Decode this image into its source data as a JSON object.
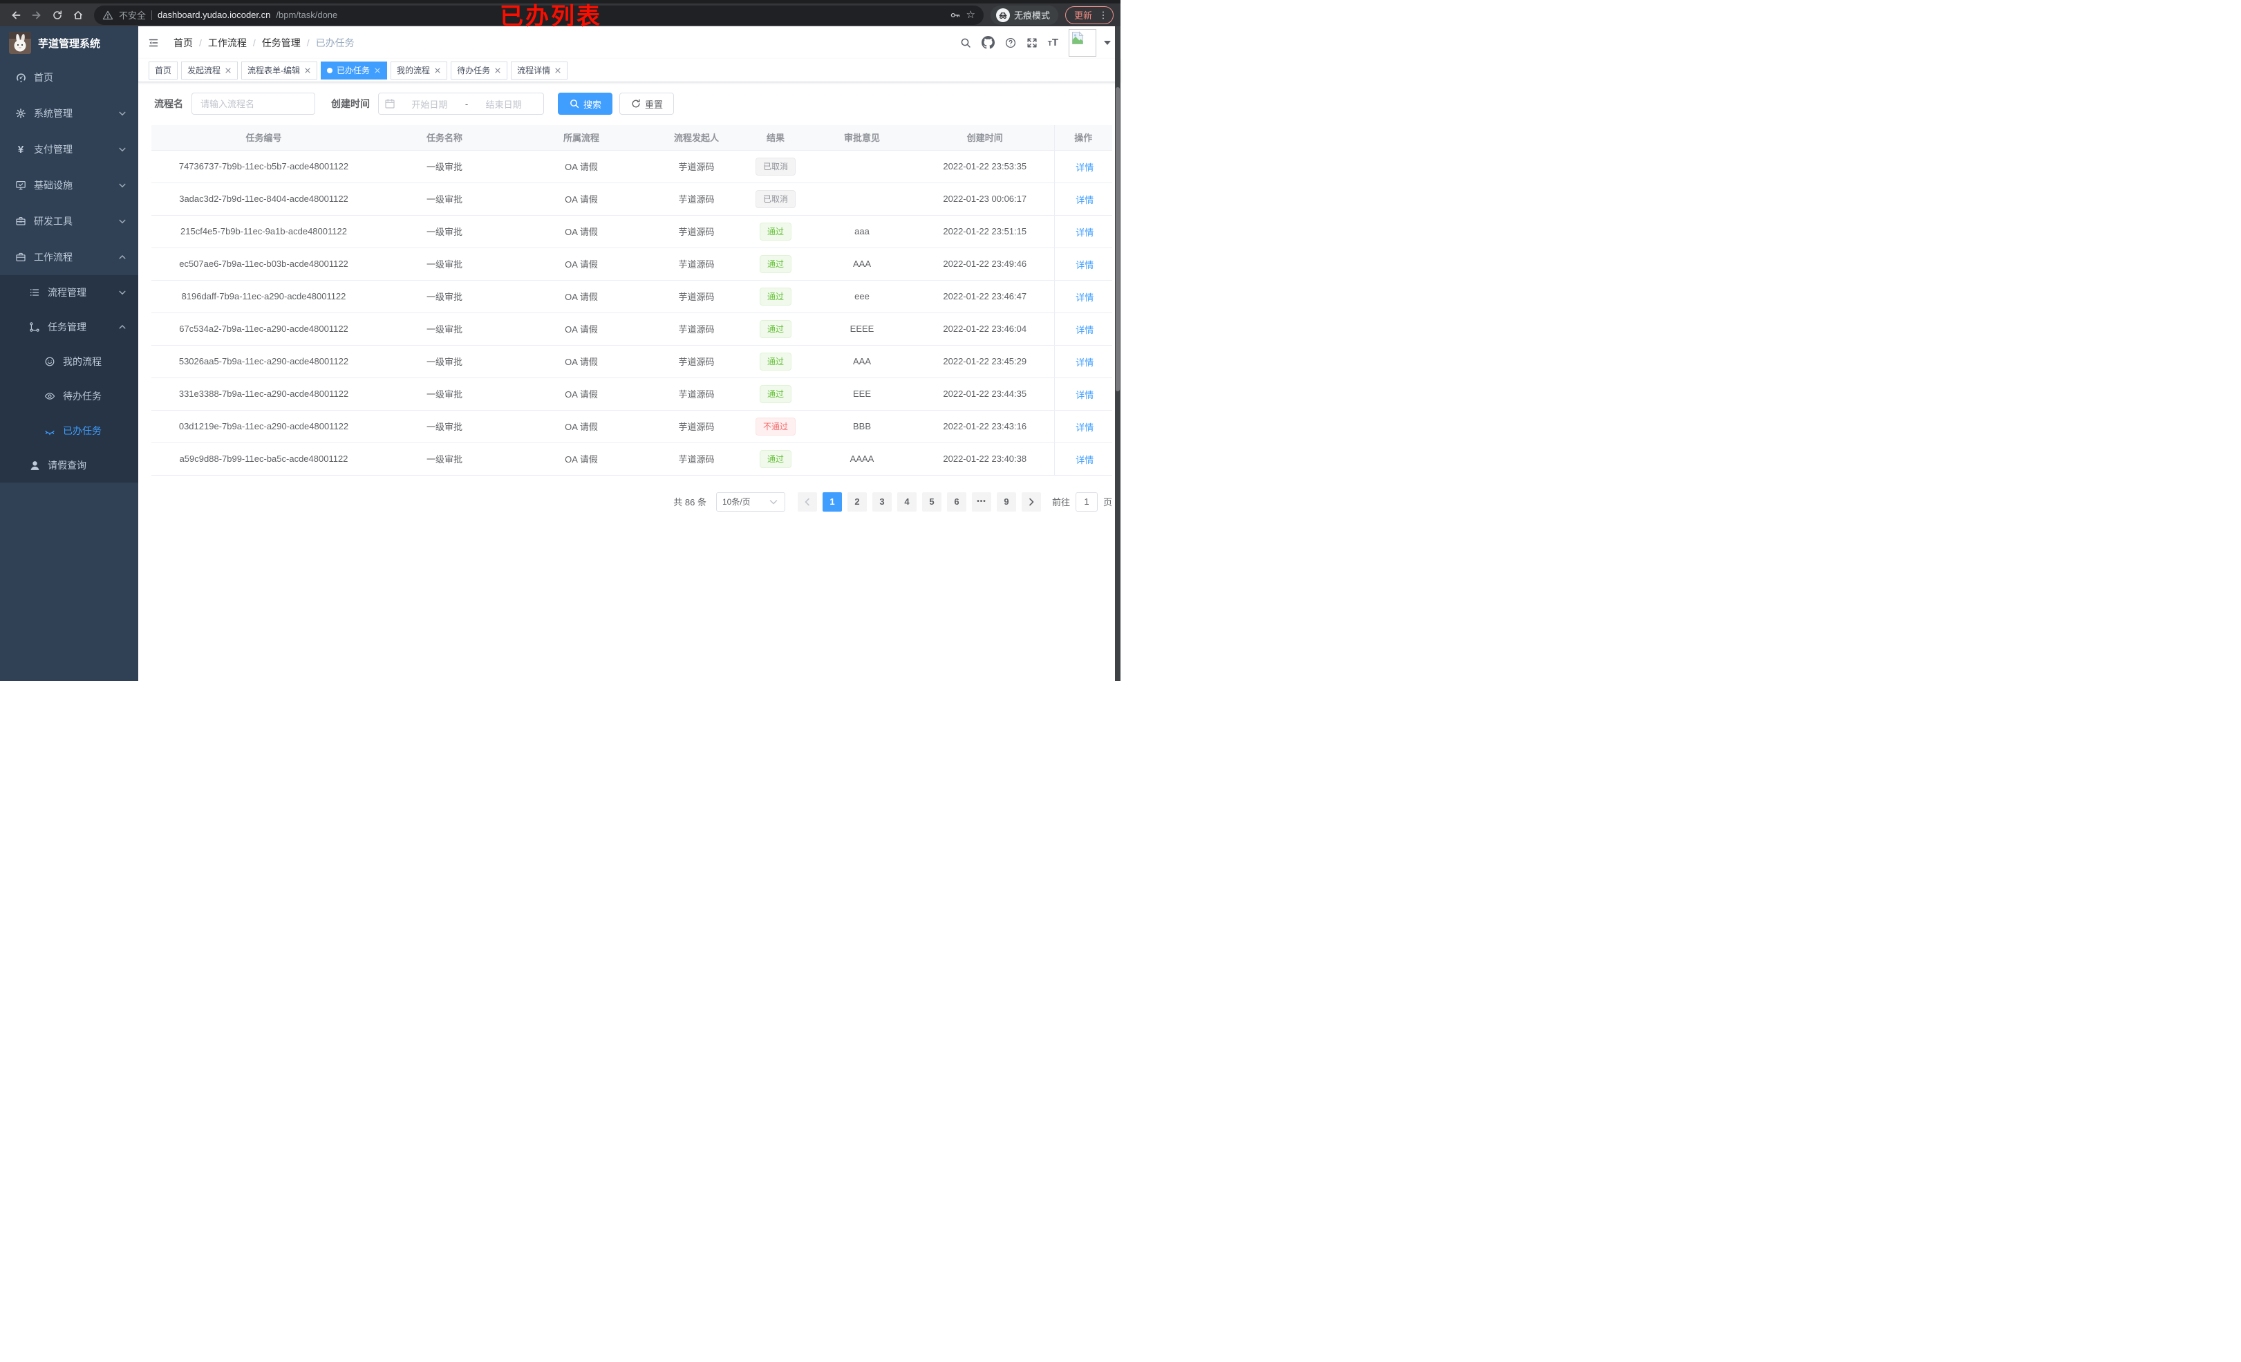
{
  "annotation_label": "已办列表",
  "browser": {
    "security_label": "不安全",
    "url_host": "dashboard.yudao.iocoder.cn",
    "url_path": "/bpm/task/done",
    "incognito_label": "无痕模式",
    "update_label": "更新"
  },
  "sidebar": {
    "app_title": "芋道管理系统",
    "menu": [
      {
        "label": "首页",
        "icon": "dashboard",
        "level": 1,
        "arrow": "",
        "dark": false,
        "active": false
      },
      {
        "label": "系统管理",
        "icon": "gear",
        "level": 1,
        "arrow": "down",
        "dark": false,
        "active": false
      },
      {
        "label": "支付管理",
        "icon": "yen",
        "level": 1,
        "arrow": "down",
        "dark": false,
        "active": false
      },
      {
        "label": "基础设施",
        "icon": "monitor",
        "level": 1,
        "arrow": "down",
        "dark": false,
        "active": false
      },
      {
        "label": "研发工具",
        "icon": "toolbox",
        "level": 1,
        "arrow": "down",
        "dark": false,
        "active": false
      },
      {
        "label": "工作流程",
        "icon": "briefcase",
        "level": 1,
        "arrow": "up",
        "dark": false,
        "active": false
      },
      {
        "label": "流程管理",
        "icon": "list",
        "level": 2,
        "arrow": "down",
        "dark": true,
        "active": false
      },
      {
        "label": "任务管理",
        "icon": "flow",
        "level": 2,
        "arrow": "up",
        "dark": true,
        "active": false
      },
      {
        "label": "我的流程",
        "icon": "face",
        "level": 3,
        "arrow": "",
        "dark": true,
        "active": false
      },
      {
        "label": "待办任务",
        "icon": "eye",
        "level": 3,
        "arrow": "",
        "dark": true,
        "active": false
      },
      {
        "label": "已办任务",
        "icon": "eye-closed",
        "level": 3,
        "arrow": "",
        "dark": true,
        "active": true
      },
      {
        "label": "请假查询",
        "icon": "user",
        "level": 2,
        "arrow": "",
        "dark": true,
        "active": false
      }
    ]
  },
  "breadcrumb": {
    "0": "首页",
    "1": "工作流程",
    "2": "任务管理",
    "3": "已办任务"
  },
  "tabs": [
    {
      "label": "首页",
      "closable": false,
      "active": false
    },
    {
      "label": "发起流程",
      "closable": true,
      "active": false
    },
    {
      "label": "流程表单-编辑",
      "closable": true,
      "active": false
    },
    {
      "label": "已办任务",
      "closable": true,
      "active": true
    },
    {
      "label": "我的流程",
      "closable": true,
      "active": false
    },
    {
      "label": "待办任务",
      "closable": true,
      "active": false
    },
    {
      "label": "流程详情",
      "closable": true,
      "active": false
    }
  ],
  "filters": {
    "process_name_label": "流程名",
    "process_name_placeholder": "请输入流程名",
    "create_time_label": "创建时间",
    "date_start_placeholder": "开始日期",
    "date_separator": "-",
    "date_end_placeholder": "结束日期",
    "search_label": "搜索",
    "reset_label": "重置"
  },
  "table": {
    "columns": {
      "0": "任务编号",
      "1": "任务名称",
      "2": "所属流程",
      "3": "流程发起人",
      "4": "结果",
      "5": "审批意见",
      "6": "创建时间",
      "7": "操作"
    },
    "action_label": "详情",
    "rows": [
      {
        "id": "74736737-7b9b-11ec-b5b7-acde48001122",
        "name": "一级审批",
        "process": "OA 请假",
        "starter": "芋道源码",
        "result": "已取消",
        "result_type": "info",
        "comment": "",
        "created": "2022-01-22 23:53:35"
      },
      {
        "id": "3adac3d2-7b9d-11ec-8404-acde48001122",
        "name": "一级审批",
        "process": "OA 请假",
        "starter": "芋道源码",
        "result": "已取消",
        "result_type": "info",
        "comment": "",
        "created": "2022-01-23 00:06:17"
      },
      {
        "id": "215cf4e5-7b9b-11ec-9a1b-acde48001122",
        "name": "一级审批",
        "process": "OA 请假",
        "starter": "芋道源码",
        "result": "通过",
        "result_type": "success",
        "comment": "aaa",
        "created": "2022-01-22 23:51:15"
      },
      {
        "id": "ec507ae6-7b9a-11ec-b03b-acde48001122",
        "name": "一级审批",
        "process": "OA 请假",
        "starter": "芋道源码",
        "result": "通过",
        "result_type": "success",
        "comment": "AAA",
        "created": "2022-01-22 23:49:46"
      },
      {
        "id": "8196daff-7b9a-11ec-a290-acde48001122",
        "name": "一级审批",
        "process": "OA 请假",
        "starter": "芋道源码",
        "result": "通过",
        "result_type": "success",
        "comment": "eee",
        "created": "2022-01-22 23:46:47"
      },
      {
        "id": "67c534a2-7b9a-11ec-a290-acde48001122",
        "name": "一级审批",
        "process": "OA 请假",
        "starter": "芋道源码",
        "result": "通过",
        "result_type": "success",
        "comment": "EEEE",
        "created": "2022-01-22 23:46:04"
      },
      {
        "id": "53026aa5-7b9a-11ec-a290-acde48001122",
        "name": "一级审批",
        "process": "OA 请假",
        "starter": "芋道源码",
        "result": "通过",
        "result_type": "success",
        "comment": "AAA",
        "created": "2022-01-22 23:45:29"
      },
      {
        "id": "331e3388-7b9a-11ec-a290-acde48001122",
        "name": "一级审批",
        "process": "OA 请假",
        "starter": "芋道源码",
        "result": "通过",
        "result_type": "success",
        "comment": "EEE",
        "created": "2022-01-22 23:44:35"
      },
      {
        "id": "03d1219e-7b9a-11ec-a290-acde48001122",
        "name": "一级审批",
        "process": "OA 请假",
        "starter": "芋道源码",
        "result": "不通过",
        "result_type": "danger",
        "comment": "BBB",
        "created": "2022-01-22 23:43:16"
      },
      {
        "id": "a59c9d88-7b99-11ec-ba5c-acde48001122",
        "name": "一级审批",
        "process": "OA 请假",
        "starter": "芋道源码",
        "result": "通过",
        "result_type": "success",
        "comment": "AAAA",
        "created": "2022-01-22 23:40:38"
      }
    ]
  },
  "pagination": {
    "total_label": "共 86 条",
    "page_size_label": "10条/页",
    "pages": [
      "1",
      "2",
      "3",
      "4",
      "5",
      "6",
      "•••",
      "9"
    ],
    "active_page": "1",
    "goto_label": "前往",
    "goto_value": "1",
    "page_unit_label": "页"
  },
  "colors": {
    "accent": "#409eff",
    "success": "#67c23a",
    "danger": "#f56c6c",
    "info": "#909399",
    "sidebar_bg": "#304156",
    "submenu_bg": "#263445",
    "chrome_bg": "#35363a",
    "annotation": "#fb0e00"
  }
}
